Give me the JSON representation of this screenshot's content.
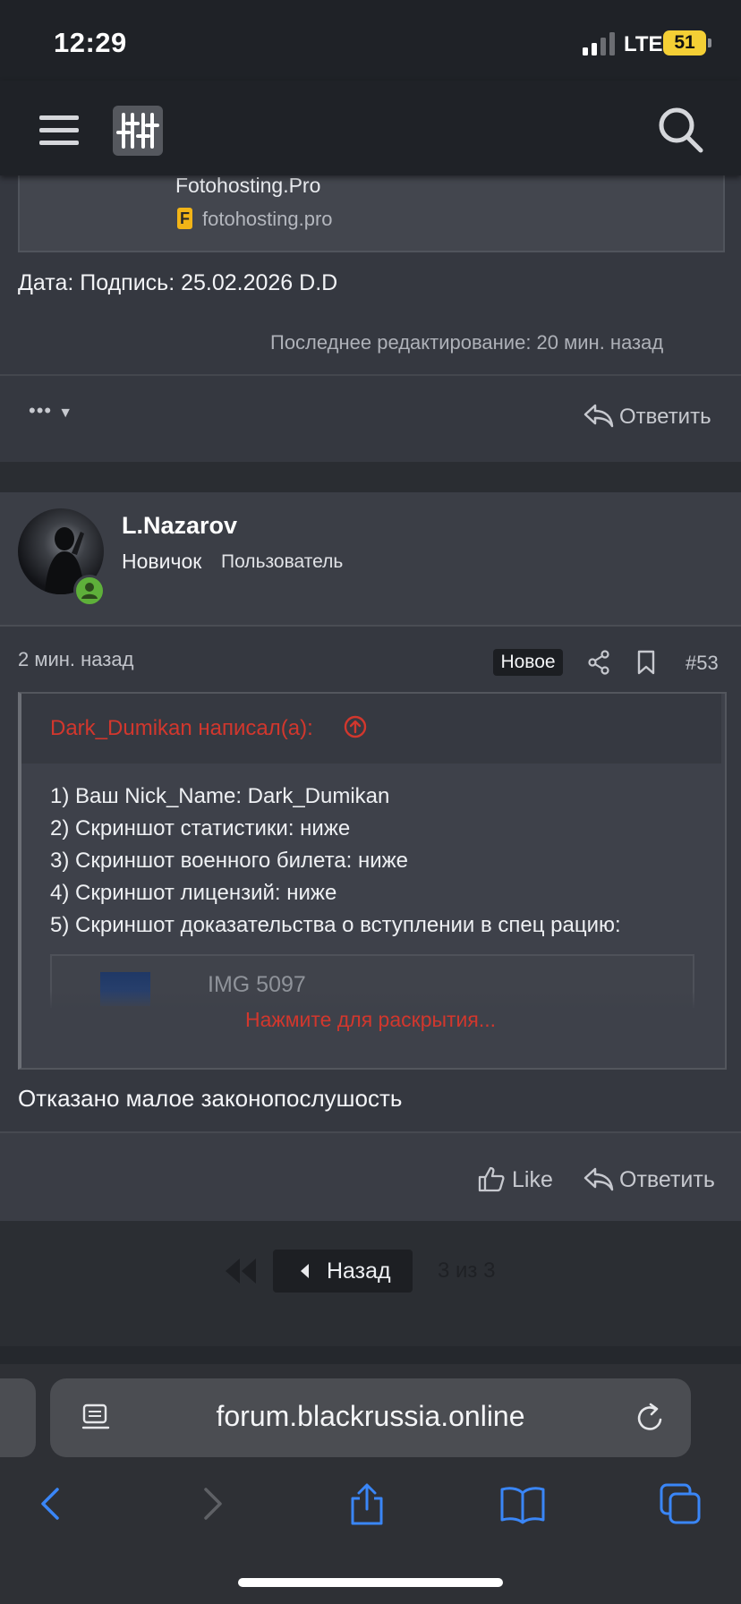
{
  "status_bar": {
    "time": "12:29",
    "network": "LTE",
    "battery": "51"
  },
  "prev_post": {
    "embed_title": "Fotohosting.Pro",
    "embed_favicon": "F",
    "embed_url": "fotohosting.pro",
    "date_line": "Дата: Подпись: 25.02.2026 D.D",
    "edited": "Последнее редактирование: 20 мин. назад",
    "more": "•••",
    "reply": "Ответить"
  },
  "post": {
    "username": "L.Nazarov",
    "rank": "Новичок",
    "user_title": "Пользователь",
    "time": "2 мин. назад",
    "badge": "Новое",
    "number": "#53",
    "quote": {
      "author": "Dark_Dumikan написал(а):",
      "lines": [
        "1) Ваш Nick_Name: Dark_Dumikan",
        "2) Скриншот статистики: ниже",
        "3) Скриншот военного билета: ниже",
        "4) Скриншот лицензий: ниже",
        "5) Скриншот доказательства о вступлении в спец рацию:"
      ],
      "image_name": "IMG 5097",
      "expand": "Нажмите для раскрытия..."
    },
    "body": "Отказано малое законопослушость",
    "like": "Like",
    "reply": "Ответить"
  },
  "pagination": {
    "back": "Назад",
    "info": "3 из 3"
  },
  "browser": {
    "address": "forum.blackrussia.online"
  },
  "colors": {
    "quote_author": "#d2372d",
    "online": "#5eb03a",
    "safari_blue": "#3a86f7"
  }
}
